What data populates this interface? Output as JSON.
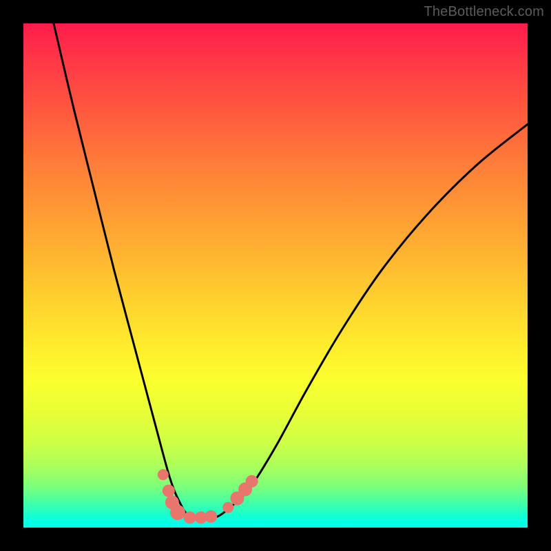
{
  "watermark": "TheBottleneck.com",
  "chart_data": {
    "type": "line",
    "title": "",
    "xlabel": "",
    "ylabel": "",
    "xlim": [
      0,
      1
    ],
    "ylim": [
      0,
      1
    ],
    "grid": false,
    "legend": false,
    "series": [
      {
        "name": "curve",
        "x": [
          0.06,
          0.1,
          0.14,
          0.18,
          0.22,
          0.26,
          0.29,
          0.31,
          0.33,
          0.35,
          0.38,
          0.41,
          0.45,
          0.5,
          0.56,
          0.63,
          0.71,
          0.8,
          0.9,
          1.0
        ],
        "y": [
          1.0,
          0.83,
          0.67,
          0.51,
          0.36,
          0.21,
          0.1,
          0.05,
          0.02,
          0.02,
          0.02,
          0.04,
          0.08,
          0.16,
          0.27,
          0.39,
          0.51,
          0.62,
          0.72,
          0.8
        ]
      }
    ],
    "markers": [
      {
        "x": 0.277,
        "y": 0.105,
        "r": 8
      },
      {
        "x": 0.288,
        "y": 0.073,
        "r": 9
      },
      {
        "x": 0.295,
        "y": 0.05,
        "r": 10
      },
      {
        "x": 0.306,
        "y": 0.03,
        "r": 11
      },
      {
        "x": 0.33,
        "y": 0.02,
        "r": 9
      },
      {
        "x": 0.352,
        "y": 0.02,
        "r": 9
      },
      {
        "x": 0.372,
        "y": 0.022,
        "r": 9
      },
      {
        "x": 0.406,
        "y": 0.04,
        "r": 8
      },
      {
        "x": 0.424,
        "y": 0.058,
        "r": 10
      },
      {
        "x": 0.44,
        "y": 0.076,
        "r": 10
      },
      {
        "x": 0.453,
        "y": 0.092,
        "r": 9
      }
    ],
    "marker_color": "#e9766c",
    "curve_color": "#000000",
    "curve_width": 3
  }
}
